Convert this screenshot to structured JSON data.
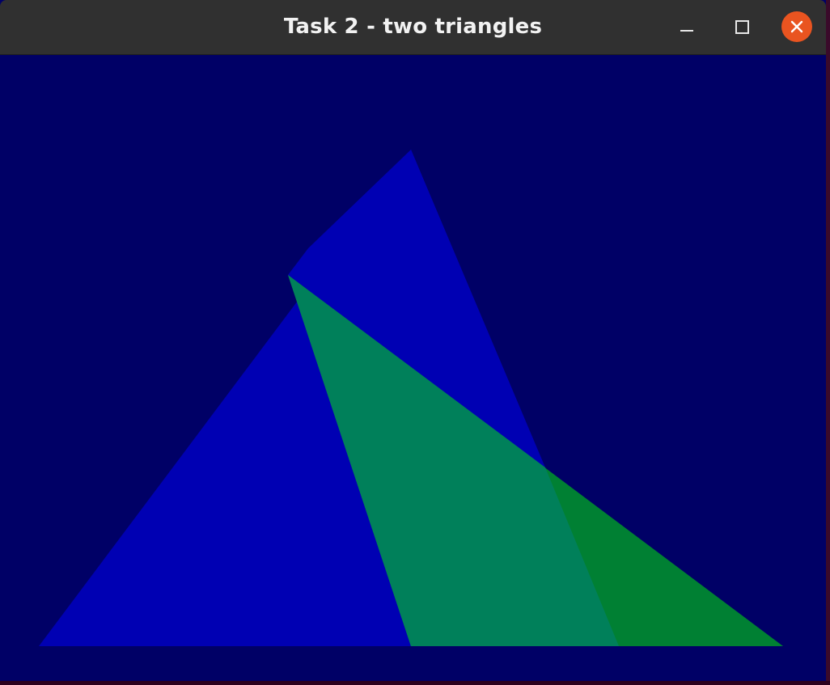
{
  "window": {
    "title": "Task 2 - two triangles",
    "controls": {
      "minimize_icon": "minimize-icon",
      "maximize_icon": "maximize-icon",
      "close_icon": "close-icon"
    }
  },
  "colors": {
    "titlebar": "#303030",
    "title_text": "#f2f2f2",
    "close_accent": "#e95420",
    "canvas_background": "#000066",
    "triangle_blue": "#0000b3",
    "triangle_green": "#008033",
    "overlap": "#00805a"
  }
}
